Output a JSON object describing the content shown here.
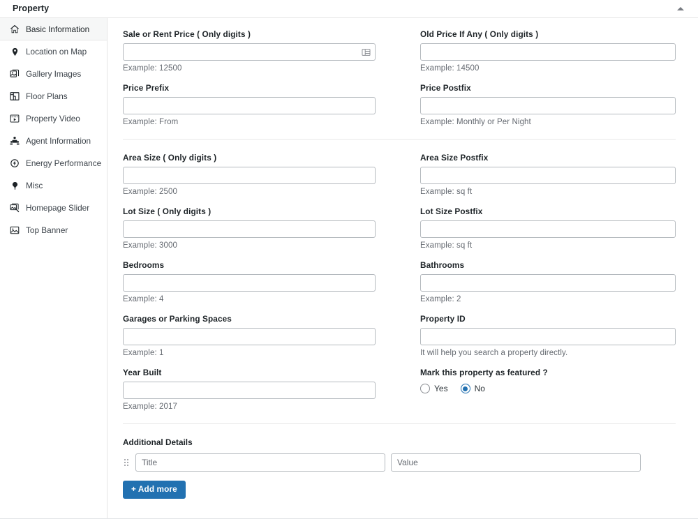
{
  "header": {
    "title": "Property",
    "toggle_icon": "chevron-up-icon"
  },
  "sidebar": {
    "items": [
      {
        "label": "Basic Information",
        "icon": "home-icon",
        "active": true
      },
      {
        "label": "Location on Map",
        "icon": "map-pin-icon",
        "active": false
      },
      {
        "label": "Gallery Images",
        "icon": "images-icon",
        "active": false
      },
      {
        "label": "Floor Plans",
        "icon": "floor-plan-icon",
        "active": false
      },
      {
        "label": "Property Video",
        "icon": "video-icon",
        "active": false
      },
      {
        "label": "Agent Information",
        "icon": "agent-icon",
        "active": false
      },
      {
        "label": "Energy Performance",
        "icon": "energy-icon",
        "active": false
      },
      {
        "label": "Misc",
        "icon": "lightbulb-icon",
        "active": false
      },
      {
        "label": "Homepage Slider",
        "icon": "slider-icon",
        "active": false
      },
      {
        "label": "Top Banner",
        "icon": "banner-image-icon",
        "active": false
      }
    ]
  },
  "form": {
    "section1": {
      "left": [
        {
          "label": "Sale or Rent Price ( Only digits )",
          "value": "",
          "placeholder": "",
          "hint": "Example: 12500",
          "trailing_icon": "table-list-icon"
        },
        {
          "label": "Price Prefix",
          "value": "",
          "placeholder": "",
          "hint": "Example: From",
          "trailing_icon": ""
        }
      ],
      "right": [
        {
          "label": "Old Price If Any ( Only digits )",
          "value": "",
          "placeholder": "",
          "hint": "Example: 14500",
          "trailing_icon": ""
        },
        {
          "label": "Price Postfix",
          "value": "",
          "placeholder": "",
          "hint": "Example: Monthly or Per Night",
          "trailing_icon": ""
        }
      ]
    },
    "section2": {
      "left": [
        {
          "label": "Area Size ( Only digits )",
          "value": "",
          "placeholder": "",
          "hint": "Example: 2500"
        },
        {
          "label": "Lot Size ( Only digits )",
          "value": "",
          "placeholder": "",
          "hint": "Example: 3000"
        },
        {
          "label": "Bedrooms",
          "value": "",
          "placeholder": "",
          "hint": "Example: 4"
        },
        {
          "label": "Garages or Parking Spaces",
          "value": "",
          "placeholder": "",
          "hint": "Example: 1"
        },
        {
          "label": "Year Built",
          "value": "",
          "placeholder": "",
          "hint": "Example: 2017"
        }
      ],
      "right": [
        {
          "label": "Area Size Postfix",
          "value": "",
          "placeholder": "",
          "hint": "Example: sq ft"
        },
        {
          "label": "Lot Size Postfix",
          "value": "",
          "placeholder": "",
          "hint": "Example: sq ft"
        },
        {
          "label": "Bathrooms",
          "value": "",
          "placeholder": "",
          "hint": "Example: 2"
        },
        {
          "label": "Property ID",
          "value": "",
          "placeholder": "",
          "hint": "It will help you search a property directly."
        }
      ],
      "featured": {
        "label": "Mark this property as featured ?",
        "options": [
          {
            "label": "Yes",
            "selected": false
          },
          {
            "label": "No",
            "selected": true
          }
        ]
      }
    },
    "additional_details": {
      "label": "Additional Details",
      "grip_icon": "drag-handle-icon",
      "rows": [
        {
          "title_value": "",
          "title_placeholder": "Title",
          "value_value": "",
          "value_placeholder": "Value"
        }
      ],
      "add_button": "+ Add more"
    }
  },
  "colors": {
    "accent": "#2271b1",
    "text": "#1d2327",
    "muted": "#646970",
    "border": "#b4b9be",
    "divider": "#e5e5e5"
  }
}
